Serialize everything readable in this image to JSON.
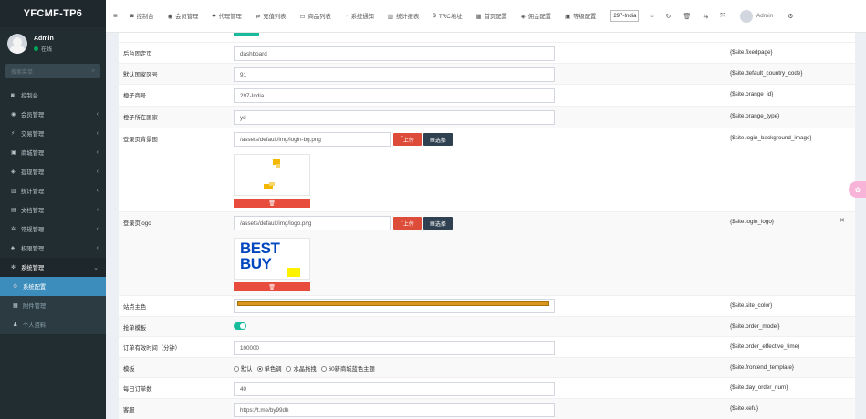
{
  "sidebar": {
    "brand": "YFCMF-TP6",
    "user": {
      "name": "Admin",
      "status": "在线"
    },
    "search_placeholder": "搜索菜单",
    "items": [
      {
        "label": "控制台",
        "icon": "dashboard-icon",
        "chev": ""
      },
      {
        "label": "会员管理",
        "icon": "user-circle-icon",
        "chev": "‹"
      },
      {
        "label": "交易管理",
        "icon": "bolt-icon",
        "chev": "‹"
      },
      {
        "label": "商城管理",
        "icon": "shop-icon",
        "chev": "‹"
      },
      {
        "label": "提现管理",
        "icon": "money-icon",
        "chev": "‹"
      },
      {
        "label": "统计管理",
        "icon": "chart-icon",
        "chev": "‹"
      },
      {
        "label": "文档管理",
        "icon": "file-icon",
        "chev": "‹"
      },
      {
        "label": "常规管理",
        "icon": "cog-icon",
        "chev": "‹"
      },
      {
        "label": "权限管理",
        "icon": "group-icon",
        "chev": "‹"
      },
      {
        "label": "系统管理",
        "icon": "cogs-icon",
        "chev": "⌄"
      },
      {
        "label": "系统配置",
        "icon": "gear-icon",
        "chev": ""
      },
      {
        "label": "附件管理",
        "icon": "attachment-icon",
        "chev": ""
      },
      {
        "label": "个人资料",
        "icon": "profile-icon",
        "chev": ""
      }
    ]
  },
  "topbar": {
    "menu": [
      {
        "label": "控制台",
        "icon": "◙"
      },
      {
        "label": "会员管理",
        "icon": "◉"
      },
      {
        "label": "代理管理",
        "icon": "♣"
      },
      {
        "label": "充值列表",
        "icon": "⇄"
      },
      {
        "label": "商品列表",
        "icon": "▭"
      },
      {
        "label": "系统通知",
        "icon": "◔"
      },
      {
        "label": "统计报表",
        "icon": "▥"
      },
      {
        "label": "TRC地址",
        "icon": "$"
      },
      {
        "label": "首页配置",
        "icon": "▦"
      },
      {
        "label": "佣金配置",
        "icon": "◈"
      },
      {
        "label": "等级配置",
        "icon": "▣"
      }
    ],
    "language": "297-India",
    "admin": "Admin"
  },
  "form": {
    "rows": [
      {
        "label": "后台固定页",
        "value": "dashboard",
        "var": "{$site.fixedpage}"
      },
      {
        "label": "默认国家区号",
        "value": "91",
        "var": "{$site.default_country_code}"
      },
      {
        "label": "橙子商号",
        "value": "297-India",
        "var": "{$site.orange_id}"
      },
      {
        "label": "橙子所在国家",
        "value": "yd",
        "var": "{$site.orange_type}"
      },
      {
        "label": "登录页背景图",
        "value": "/assets/default/img/login-bg.png",
        "var": "{$site.login_background_image}",
        "upload": "上传",
        "select": "选择"
      },
      {
        "label": "登录页logo",
        "value": "/assets/default/img/logo.png",
        "var": "{$site.login_logo}",
        "upload": "上传",
        "select": "选择"
      },
      {
        "label": "站点主色",
        "var": "{$site.site_color}"
      },
      {
        "label": "抢单模板",
        "var": "{$site.order_model}"
      },
      {
        "label": "订单有效时间（分钟）",
        "value": "100000",
        "var": "{$site.order_effective_time}"
      },
      {
        "label": "模板",
        "var": "{$site.frontend_template}"
      },
      {
        "label": "每日订单数",
        "value": "40",
        "var": "{$site.day_order_num}"
      },
      {
        "label": "客服",
        "value": "https://t.me/by99dh",
        "var": "{$site.kefu}"
      }
    ],
    "logo_text": [
      "BEST",
      "BUY"
    ],
    "delete_label": "🗑",
    "site_color": "#d9961a",
    "template_options": [
      "默认",
      "单色调",
      "水晶拖拽",
      "60新商城蓝色主题"
    ],
    "template_selected": "单色调",
    "order_model_enabled": true
  }
}
